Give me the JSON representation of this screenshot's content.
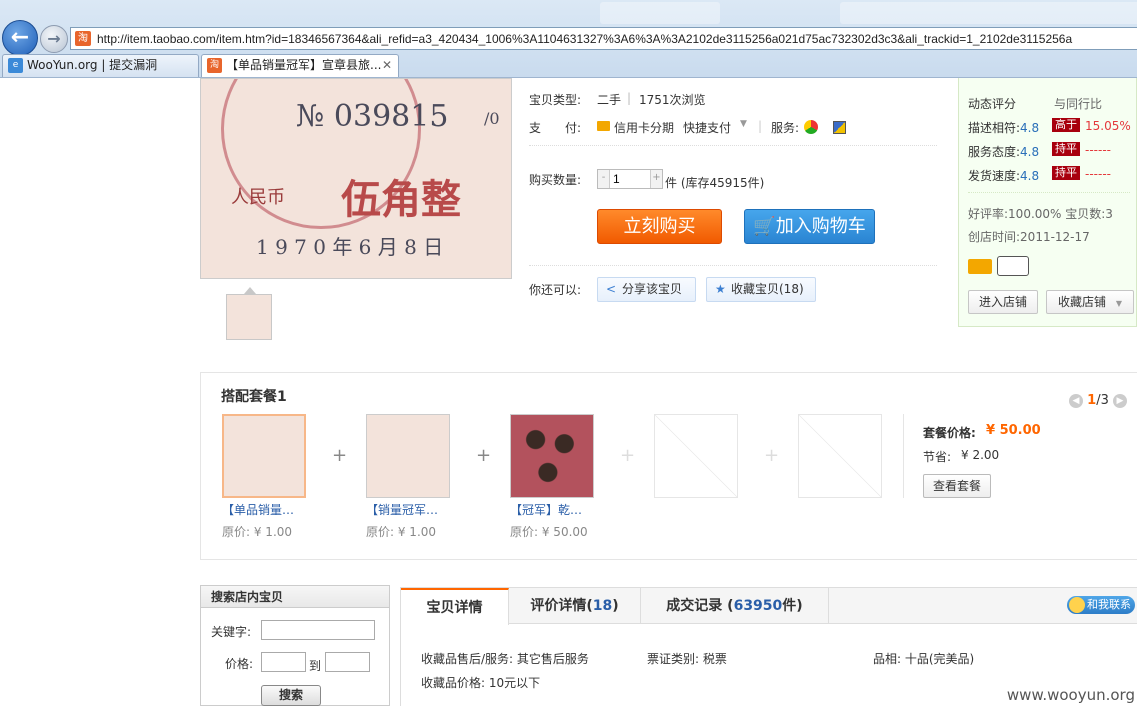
{
  "browser": {
    "url": "http://item.taobao.com/item.htm?id=18346567364&ali_refid=a3_420434_1006%3A1104631327%3A6%3A%3A2102de3115256a021d75ac732302d3c3&ali_trackid=1_2102de3115256a",
    "addr_icon": "淘",
    "tabs": [
      {
        "label": "WooYun.org | 提交漏洞",
        "icon": "e"
      },
      {
        "label": "【单品销量冠军】宣章县旅...",
        "icon": "淘",
        "close": "✕"
      }
    ]
  },
  "product": {
    "image_text": {
      "serial": "№ 039815",
      "fraction": "/0",
      "amount": "伍角整",
      "prefix": "人民币",
      "date": "1 9 7 0 年 6 月 8 日"
    },
    "type_label": "宝贝类型:",
    "type_value": "二手",
    "views": "1751次浏览",
    "pay_label": "支　　付:",
    "pay_credit": "信用卡分期",
    "pay_quick": "快捷支付",
    "service_label": "服务:",
    "qty_label": "购买数量:",
    "qty_value": "1",
    "qty_minus": "-",
    "qty_plus": "+",
    "stock": "件 (库存45915件)",
    "buy_label": "立刻购买",
    "cart_label": "加入购物车",
    "can_label": "你还可以:",
    "share_label": "分享该宝贝",
    "fav_label": "收藏宝贝(18)"
  },
  "shop": {
    "rating_title": "动态评分",
    "compare_title": "与同行比",
    "ratings": [
      {
        "label": "描述相符:",
        "score": "4.8",
        "badge": "高于",
        "compare": "15.05%",
        "compare_color": "#e4393c"
      },
      {
        "label": "服务态度:",
        "score": "4.8",
        "badge": "持平",
        "compare": "------",
        "compare_color": "#e4393c"
      },
      {
        "label": "发货速度:",
        "score": "4.8",
        "badge": "持平",
        "compare": "------",
        "compare_color": "#e4393c"
      }
    ],
    "good_rate": "好评率:100.00% 宝贝数:3",
    "created": "创店时间:2011-12-17",
    "enter_shop": "进入店铺",
    "fav_shop": "收藏店铺"
  },
  "combo": {
    "title": "搭配套餐1",
    "pager_current": "1",
    "pager_total": "/3",
    "items": [
      {
        "name": "【单品销量…",
        "price": "原价: ¥ 1.00"
      },
      {
        "name": "【销量冠军…",
        "price": "原价: ¥ 1.00"
      },
      {
        "name": "【冠军】乾…",
        "price": "原价: ¥ 50.00"
      }
    ],
    "plus": "+",
    "package_price_label": "套餐价格:",
    "package_price": "¥ 50.00",
    "save_label": "节省:",
    "save_value": "¥ 2.00",
    "view_label": "查看套餐"
  },
  "search": {
    "title": "搜索店内宝贝",
    "keyword_label": "关键字:",
    "price_label": "价格:",
    "to_label": "到",
    "button": "搜索"
  },
  "detail": {
    "tabs": [
      {
        "label": "宝贝详情",
        "num": ""
      },
      {
        "label": "评价详情(",
        "num": "18",
        "suffix": ")"
      },
      {
        "label": "成交记录 (",
        "num": "63950",
        "suffix": "件)"
      }
    ],
    "contact": "和我联系",
    "attrs": [
      "收藏品售后/服务: 其它售后服务",
      "票证类别: 税票",
      "品相: 十品(完美品)",
      "收藏品价格: 10元以下"
    ]
  },
  "watermark": "www.wooyun.org",
  "colors": {
    "accent_orange": "#f60",
    "price_red": "#e4393c",
    "link_blue": "#2a5ea8"
  }
}
